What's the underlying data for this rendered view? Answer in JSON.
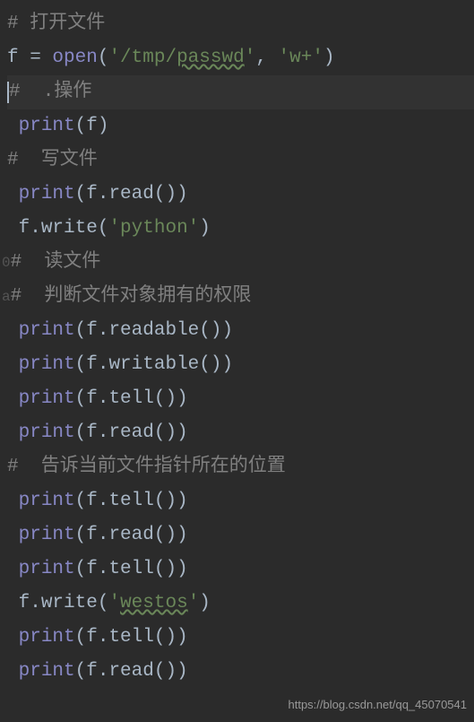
{
  "code": {
    "lines": [
      {
        "type": "comment",
        "text": "# 打开文件"
      },
      {
        "type": "assign",
        "var": "f",
        "op": " = ",
        "func": "open",
        "args": [
          {
            "str": "'/tmp/",
            "str_u": "passwd",
            "str_end": "'"
          },
          {
            "sep": ", ",
            "str": "'w+'"
          }
        ]
      },
      {
        "type": "comment-cursor",
        "text": "#  .操作"
      },
      {
        "type": "call",
        "func": "print",
        "inner": "f"
      },
      {
        "type": "comment",
        "text": "#  写文件"
      },
      {
        "type": "call",
        "func": "print",
        "inner": "f.read()"
      },
      {
        "type": "method",
        "obj": "f",
        "method": "write",
        "arg_str": "'python'"
      },
      {
        "type": "comment-gutter",
        "gutter": "0",
        "text": "#  读文件"
      },
      {
        "type": "comment-gutter",
        "gutter": "a",
        "text": "#  判断文件对象拥有的权限"
      },
      {
        "type": "call",
        "func": "print",
        "inner": "f.readable()"
      },
      {
        "type": "call",
        "func": "print",
        "inner": "f.writable()"
      },
      {
        "type": "call",
        "func": "print",
        "inner": "f.tell()"
      },
      {
        "type": "call",
        "func": "print",
        "inner": "f.read()"
      },
      {
        "type": "comment",
        "text": "#  告诉当前文件指针所在的位置"
      },
      {
        "type": "call",
        "func": "print",
        "inner": "f.tell()"
      },
      {
        "type": "call",
        "func": "print",
        "inner": "f.read()"
      },
      {
        "type": "call",
        "func": "print",
        "inner": "f.tell()"
      },
      {
        "type": "method",
        "obj": "f",
        "method": "write",
        "arg_str_pre": "'",
        "arg_str_u": "westos",
        "arg_str_post": "'"
      },
      {
        "type": "call",
        "func": "print",
        "inner": "f.tell()"
      },
      {
        "type": "call",
        "func": "print",
        "inner": "f.read()"
      }
    ]
  },
  "watermark": "https://blog.csdn.net/qq_45070541"
}
